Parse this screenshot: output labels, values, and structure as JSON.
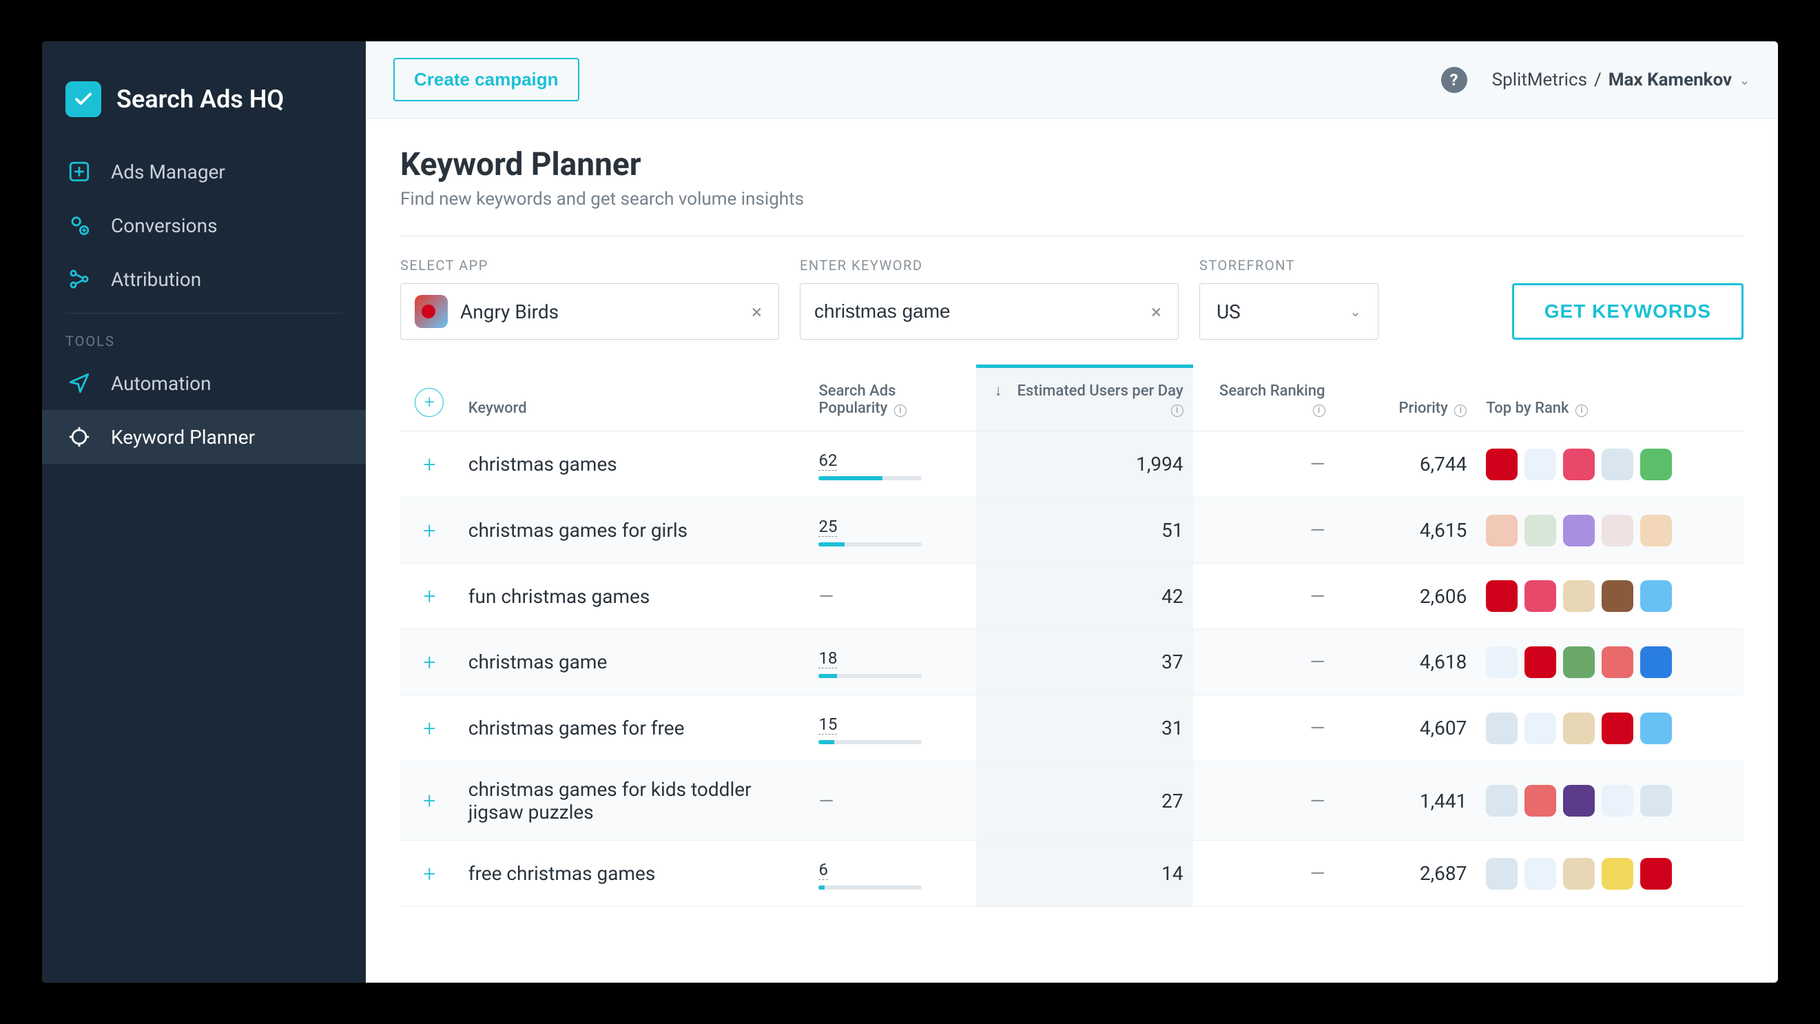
{
  "brand": {
    "name": "Search Ads HQ"
  },
  "sidebar": {
    "items": [
      {
        "label": "Ads Manager"
      },
      {
        "label": "Conversions"
      },
      {
        "label": "Attribution"
      }
    ],
    "tools_label": "TOOLS",
    "tools": [
      {
        "label": "Automation"
      },
      {
        "label": "Keyword Planner"
      }
    ]
  },
  "topbar": {
    "create_label": "Create campaign",
    "org": "SplitMetrics",
    "user": "Max Kamenkov"
  },
  "page": {
    "title": "Keyword Planner",
    "subtitle": "Find new keywords and get search volume insights"
  },
  "controls": {
    "app_label": "SELECT APP",
    "app_value": "Angry Birds",
    "kw_label": "ENTER KEYWORD",
    "kw_value": "christmas game",
    "sf_label": "STOREFRONT",
    "sf_value": "US",
    "get_label": "GET KEYWORDS"
  },
  "table": {
    "headers": {
      "keyword": "Keyword",
      "popularity": "Search Ads Popularity",
      "estimated": "Estimated Users per Day",
      "ranking": "Search Ranking",
      "priority": "Priority",
      "top": "Top by Rank"
    },
    "rows": [
      {
        "keyword": "christmas games",
        "popularity": 62,
        "estimated": "1,994",
        "ranking": "—",
        "priority": "6,744",
        "top_colors": [
          "#d0021b",
          "#eaf2fb",
          "#e8486a",
          "#d9e6ef",
          "#5bbf6a"
        ]
      },
      {
        "keyword": "christmas games for girls",
        "popularity": 25,
        "estimated": "51",
        "ranking": "—",
        "priority": "4,615",
        "top_colors": [
          "#f2c8b6",
          "#d8e6d8",
          "#a98fe0",
          "#efe2e2",
          "#f2d8b8"
        ]
      },
      {
        "keyword": "fun christmas games",
        "popularity": null,
        "estimated": "42",
        "ranking": "—",
        "priority": "2,606",
        "top_colors": [
          "#d0021b",
          "#e8486a",
          "#e8d7b4",
          "#8a5a3c",
          "#67c1f5"
        ]
      },
      {
        "keyword": "christmas game",
        "popularity": 18,
        "estimated": "37",
        "ranking": "—",
        "priority": "4,618",
        "top_colors": [
          "#eaf2fb",
          "#d0021b",
          "#6aa86a",
          "#e86a6a",
          "#2a7de1"
        ]
      },
      {
        "keyword": "christmas games for free",
        "popularity": 15,
        "estimated": "31",
        "ranking": "—",
        "priority": "4,607",
        "top_colors": [
          "#d9e6ef",
          "#eaf2fb",
          "#e8d7b4",
          "#d0021b",
          "#67c1f5"
        ]
      },
      {
        "keyword": "christmas games for kids toddler jigsaw puzzles",
        "popularity": null,
        "estimated": "27",
        "ranking": "—",
        "priority": "1,441",
        "top_colors": [
          "#d9e6ef",
          "#e86a6a",
          "#5a3c8a",
          "#eaf2fb",
          "#d9e6ef"
        ]
      },
      {
        "keyword": "free christmas games",
        "popularity": 6,
        "estimated": "14",
        "ranking": "—",
        "priority": "2,687",
        "top_colors": [
          "#d9e6ef",
          "#eaf2fb",
          "#e8d7b4",
          "#f2d85a",
          "#d0021b"
        ]
      }
    ]
  }
}
